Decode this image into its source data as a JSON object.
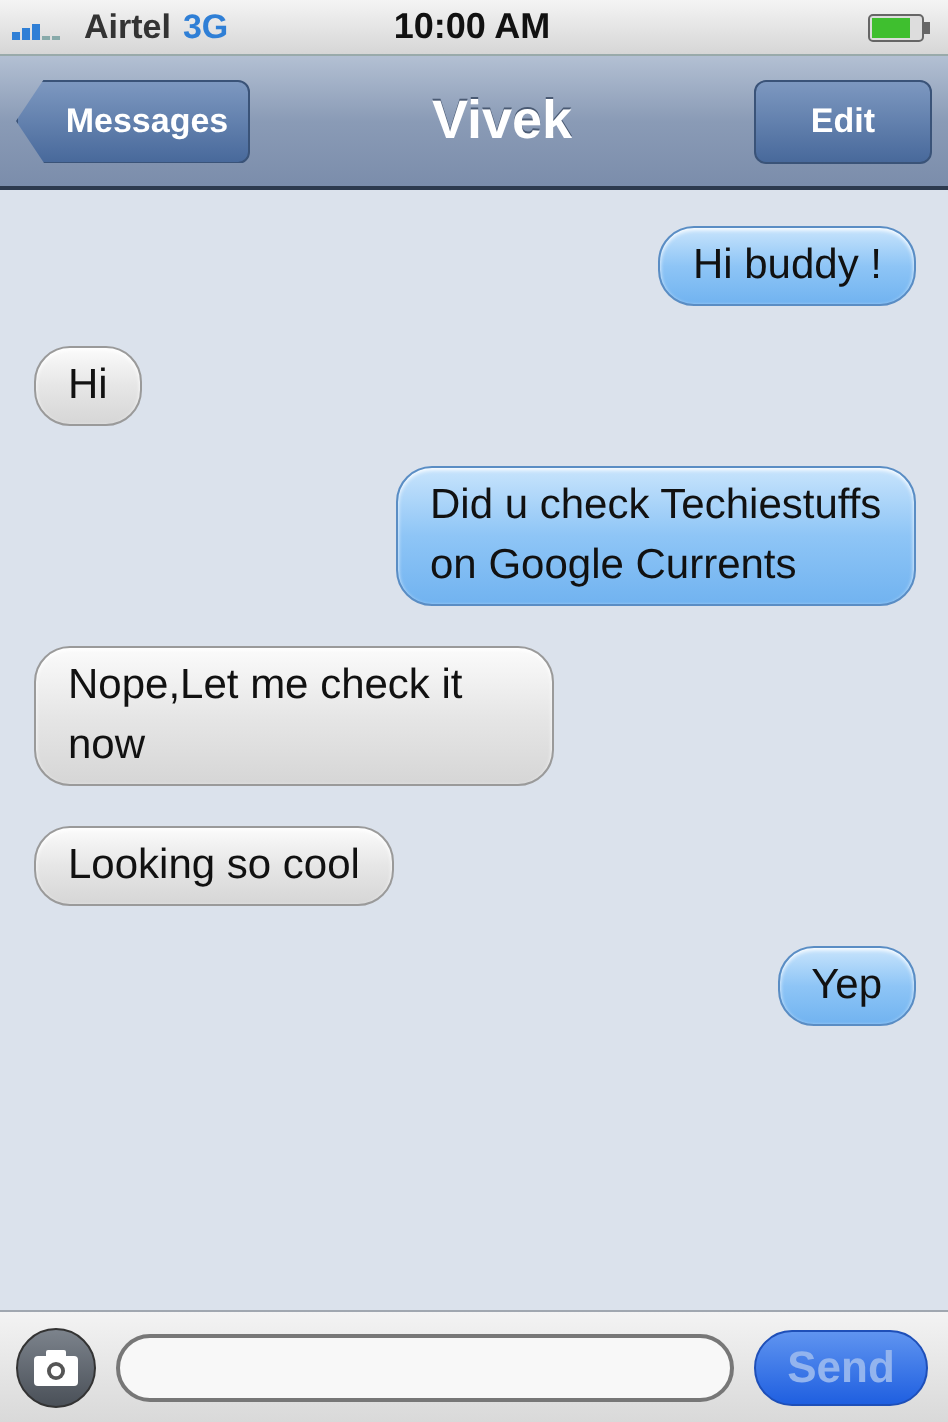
{
  "status_bar": {
    "carrier": "Airtel",
    "network": "3G",
    "time": "10:00 AM"
  },
  "nav_bar": {
    "back": "Messages",
    "title": "Vivek",
    "action": "Edit"
  },
  "messages": [
    {
      "kind": "sent",
      "text": "Hi buddy !"
    },
    {
      "kind": "received",
      "text": "Hi"
    },
    {
      "kind": "sent",
      "text": "Did u check Techiestuffs on Google Currents"
    },
    {
      "kind": "received",
      "text": "Nope,Let me check it now"
    },
    {
      "kind": "received",
      "text": "Looking so cool"
    },
    {
      "kind": "sent",
      "text": "Yep"
    }
  ],
  "composer": {
    "send": "Send",
    "send_disabled": true
  }
}
